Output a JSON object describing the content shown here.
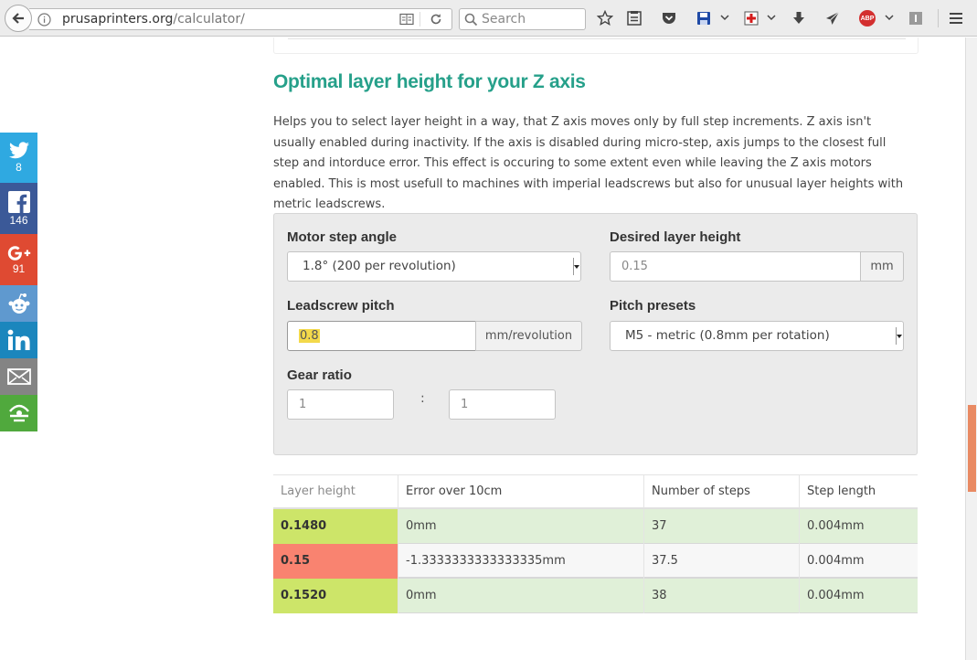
{
  "browser": {
    "url_host": "prusaprinters.org",
    "url_path": "/calculator/",
    "search_placeholder": "Search",
    "abp_label": "ABP"
  },
  "section": {
    "title": "Optimal layer height for your Z axis",
    "description": "Helps you to select layer height in a way, that Z axis moves only by full step increments. Z axis isn't usually enabled during inactivity. If the axis is disabled during micro-step, axis jumps to the closest full step and intorduce error. This effect is occuring to some extent even while leaving the Z axis motors enabled. This is most usefull to machines with imperial leadscrews but also for unusual layer heights with metric leadscrews."
  },
  "form": {
    "motor_step_label": "Motor step angle",
    "motor_step_value": "1.8° (200 per revolution)",
    "layer_height_label": "Desired layer height",
    "layer_height_value": "0.15",
    "layer_height_unit": "mm",
    "leadscrew_label": "Leadscrew pitch",
    "leadscrew_value": "0.8",
    "leadscrew_unit": "mm/revolution",
    "pitch_presets_label": "Pitch presets",
    "pitch_presets_value": "M5 - metric (0.8mm per rotation)",
    "gear_ratio_label": "Gear ratio",
    "gear_a": "1",
    "gear_separator": ":",
    "gear_b": "1"
  },
  "table": {
    "headers": [
      "Layer height",
      "Error over 10cm",
      "Number of steps",
      "Step length"
    ],
    "rows": [
      {
        "layer": "0.1480",
        "error": "0mm",
        "steps": "37",
        "step_len": "0.004mm",
        "status": "good"
      },
      {
        "layer": "0.15",
        "error": "-1.3333333333333335mm",
        "steps": "37.5",
        "step_len": "0.004mm",
        "status": "bad"
      },
      {
        "layer": "0.1520",
        "error": "0mm",
        "steps": "38",
        "step_len": "0.004mm",
        "status": "good"
      }
    ]
  },
  "social": {
    "twitter_count": "8",
    "facebook_count": "146",
    "googleplus_count": "91"
  },
  "colors": {
    "heading": "#26a08a",
    "good_cell": "#cde569",
    "good_row": "#e0f0d8",
    "bad_cell": "#f98370",
    "twitter": "#2fa9e1",
    "facebook": "#3b5998",
    "googleplus": "#df4a32",
    "reddit": "#5f99cf",
    "linkedin": "#1b86bd",
    "email": "#848484",
    "share": "#50a93d"
  }
}
